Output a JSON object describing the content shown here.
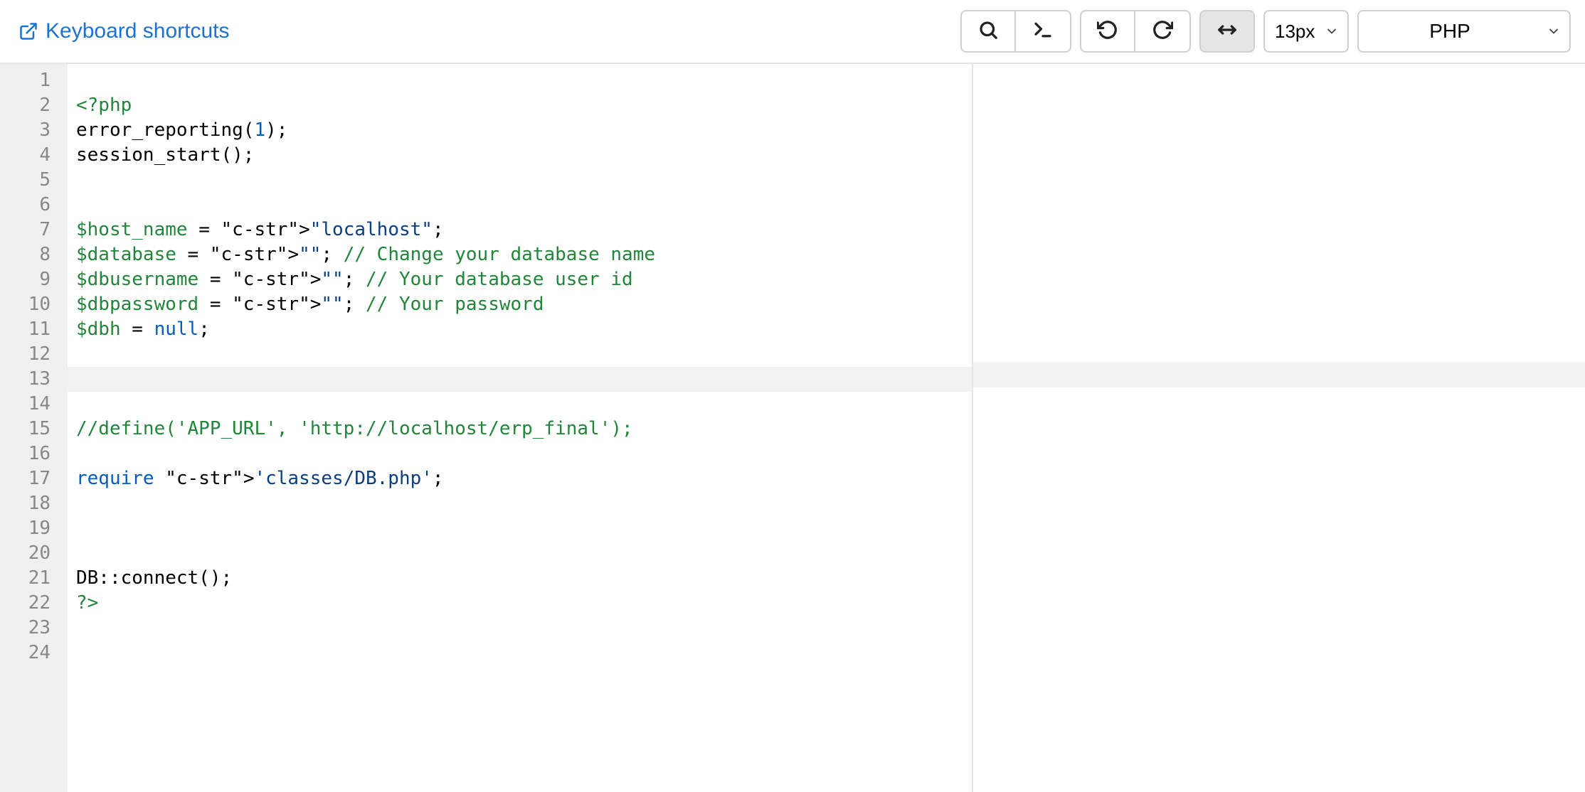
{
  "toolbar": {
    "kb_shortcuts_label": "Keyboard shortcuts",
    "font_size_label": "13px",
    "language_label": "PHP"
  },
  "code": {
    "total_lines": 24,
    "active_line": 13,
    "lines": [
      {
        "n": 1,
        "raw": ""
      },
      {
        "n": 2,
        "raw": "<?php"
      },
      {
        "n": 3,
        "raw": "error_reporting(1);"
      },
      {
        "n": 4,
        "raw": "session_start();"
      },
      {
        "n": 5,
        "raw": ""
      },
      {
        "n": 6,
        "raw": ""
      },
      {
        "n": 7,
        "raw": "$host_name = \"localhost\";"
      },
      {
        "n": 8,
        "raw": "$database = \"\"; // Change your database name"
      },
      {
        "n": 9,
        "raw": "$dbusername = \"\"; // Your database user id"
      },
      {
        "n": 10,
        "raw": "$dbpassword = \"\"; // Your password"
      },
      {
        "n": 11,
        "raw": "$dbh = null;"
      },
      {
        "n": 12,
        "raw": ""
      },
      {
        "n": 13,
        "raw": ""
      },
      {
        "n": 14,
        "raw": ""
      },
      {
        "n": 15,
        "raw": "//define('APP_URL', 'http://localhost/erp_final');"
      },
      {
        "n": 16,
        "raw": ""
      },
      {
        "n": 17,
        "raw": "require 'classes/DB.php';"
      },
      {
        "n": 18,
        "raw": ""
      },
      {
        "n": 19,
        "raw": ""
      },
      {
        "n": 20,
        "raw": ""
      },
      {
        "n": 21,
        "raw": "DB::connect();"
      },
      {
        "n": 22,
        "raw": "?>"
      },
      {
        "n": 23,
        "raw": ""
      },
      {
        "n": 24,
        "raw": ""
      }
    ]
  }
}
